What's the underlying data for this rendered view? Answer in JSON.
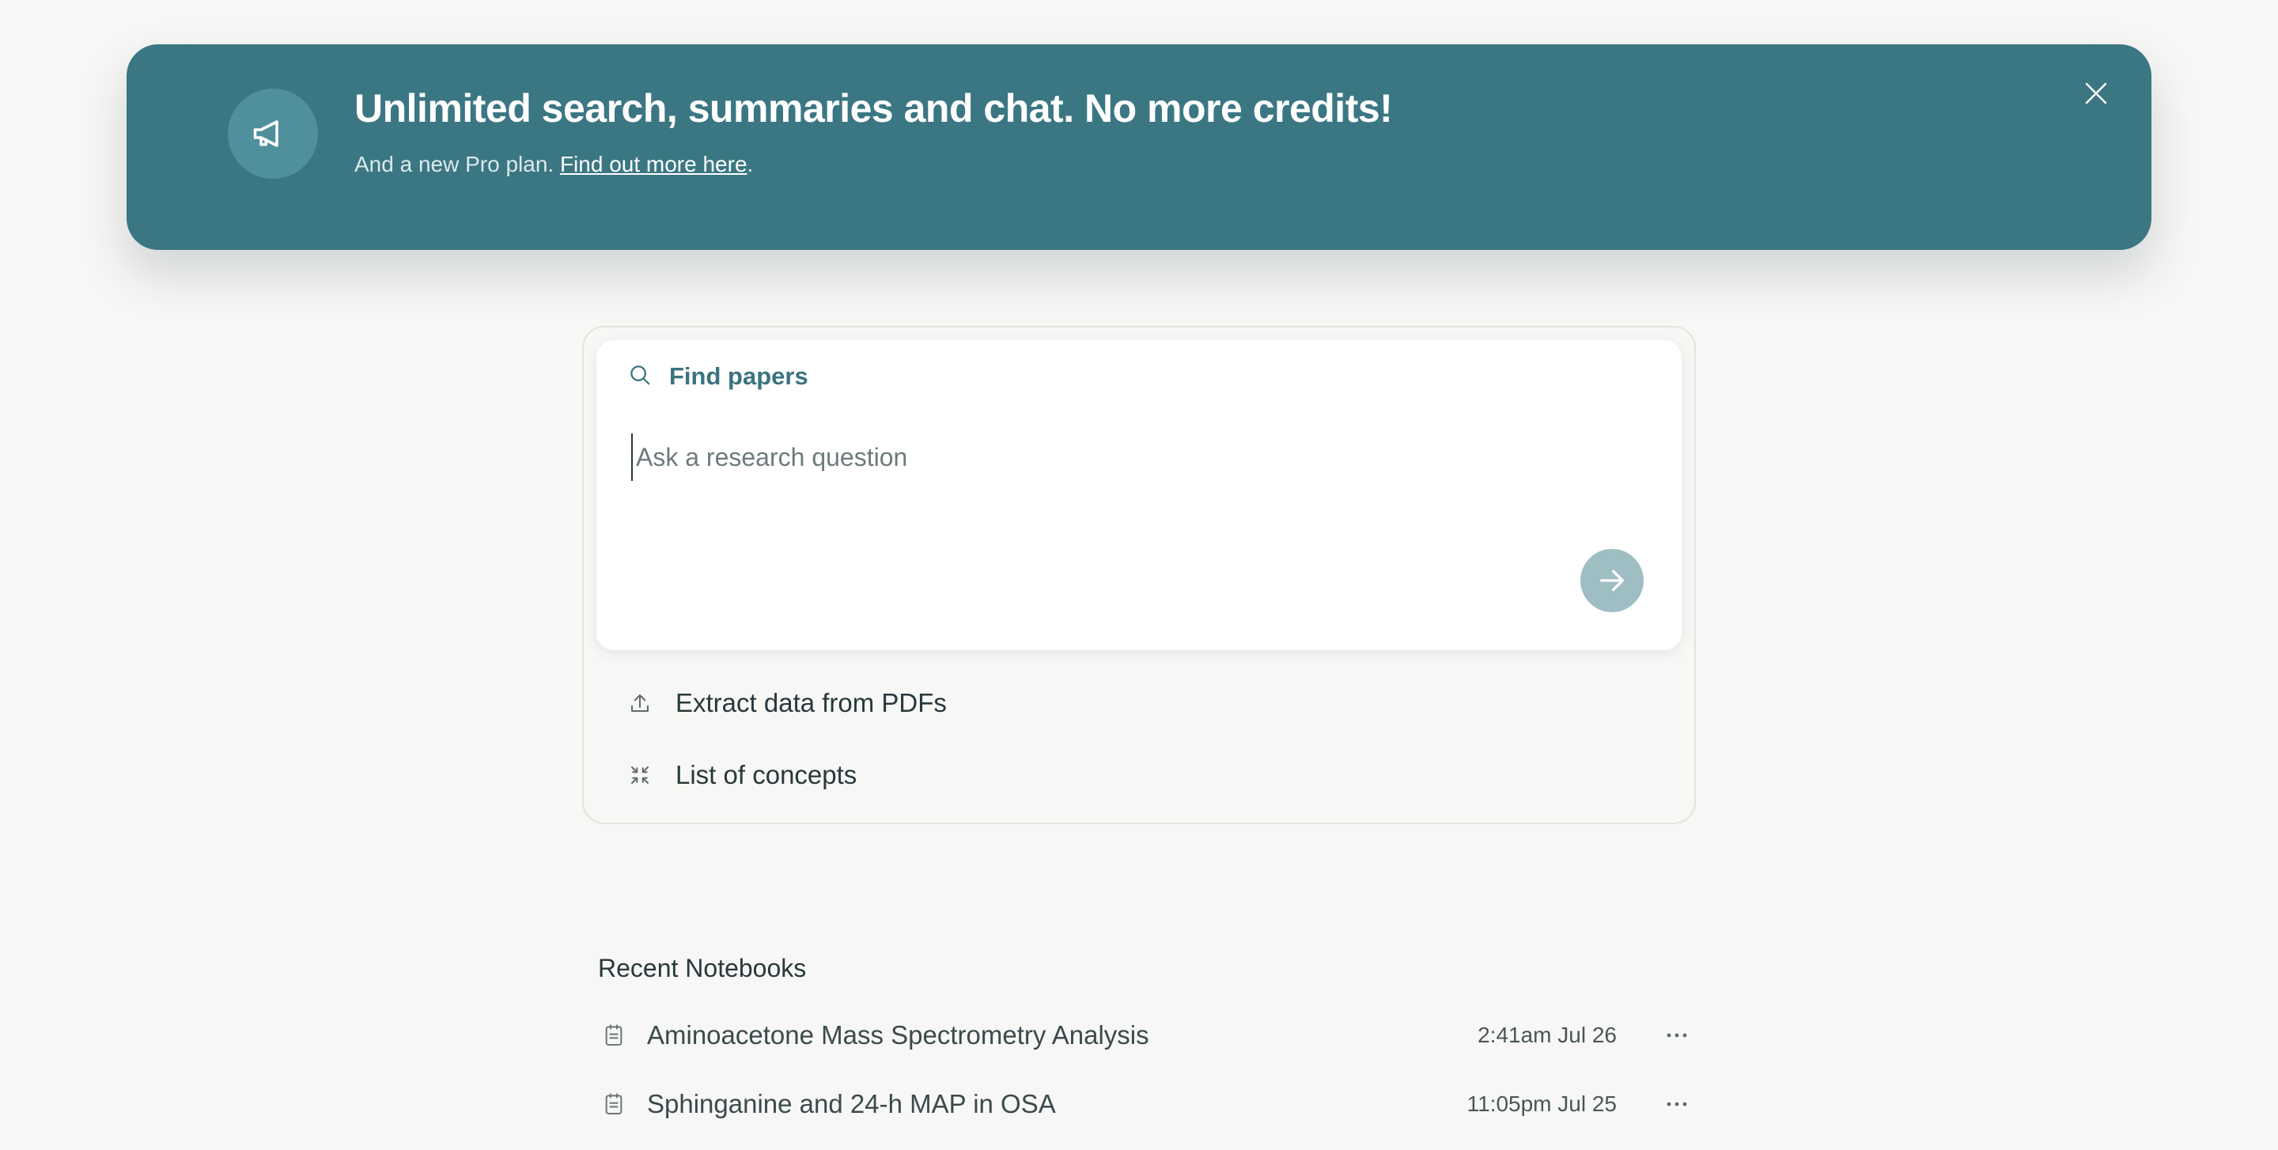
{
  "banner": {
    "icon": "megaphone-icon",
    "title": "Unlimited search, summaries and chat. No more credits!",
    "subtitle_prefix": "And a new Pro plan. ",
    "link_text": "Find out more here",
    "subtitle_suffix": ".",
    "close_icon": "close-icon",
    "bg_color": "#3b7783"
  },
  "search": {
    "mode_icon": "search-icon",
    "mode_label": "Find papers",
    "placeholder": "Ask a research question",
    "value": "",
    "submit_icon": "arrow-right-icon"
  },
  "options": [
    {
      "icon": "upload-icon",
      "label": "Extract data from PDFs"
    },
    {
      "icon": "compress-icon",
      "label": "List of concepts"
    }
  ],
  "recent": {
    "title": "Recent Notebooks",
    "items": [
      {
        "icon": "notebook-icon",
        "title": "Aminoacetone Mass Spectrometry Analysis",
        "time": "2:41am Jul 26",
        "more_icon": "more-icon"
      },
      {
        "icon": "notebook-icon",
        "title": "Sphinganine and 24-h MAP in OSA",
        "time": "11:05pm Jul 25",
        "more_icon": "more-icon"
      }
    ]
  }
}
